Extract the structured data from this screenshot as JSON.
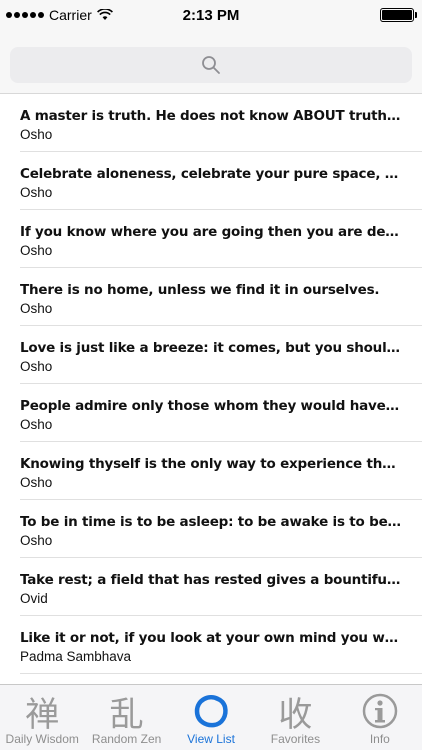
{
  "status_bar": {
    "carrier": "Carrier",
    "time": "2:13 PM"
  },
  "search": {
    "placeholder": ""
  },
  "quotes": [
    {
      "text": "A master is truth. He does not know ABOUT truth, h...",
      "author": "Osho"
    },
    {
      "text": "Celebrate aloneness, celebrate your pure space, and g...",
      "author": "Osho"
    },
    {
      "text": "If you know where you are going then you are dead..I...",
      "author": "Osho"
    },
    {
      "text": "There is no home, unless we find it in ourselves.",
      "author": "Osho"
    },
    {
      "text": "Love is just like a breeze: it comes, but you should not...",
      "author": "Osho"
    },
    {
      "text": "People admire only those whom they would have like...",
      "author": "Osho"
    },
    {
      "text": "Knowing thyself is the only way to experience the m...",
      "author": "Osho"
    },
    {
      "text": "To be in time is to be asleep: to be awake is to be in et...",
      "author": "Osho"
    },
    {
      "text": "Take rest; a field that has rested gives a bountiful cr...",
      "author": "Ovid"
    },
    {
      "text": "Like it or not, if you look at your own mind you will d...",
      "author": "Padma Sambhava"
    }
  ],
  "tabs": [
    {
      "label": "Daily Wisdom",
      "glyph": "禅",
      "icon": "zen-character-icon",
      "active": false
    },
    {
      "label": "Random Zen",
      "glyph": "乱",
      "icon": "random-character-icon",
      "active": false
    },
    {
      "label": "View List",
      "glyph": "",
      "icon": "enso-circle-icon",
      "active": true
    },
    {
      "label": "Favorites",
      "glyph": "收",
      "icon": "collect-character-icon",
      "active": false
    },
    {
      "label": "Info",
      "glyph": "",
      "icon": "info-icon",
      "active": false
    }
  ],
  "colors": {
    "accent": "#1a73d9",
    "inactive": "#9a9a9a"
  }
}
